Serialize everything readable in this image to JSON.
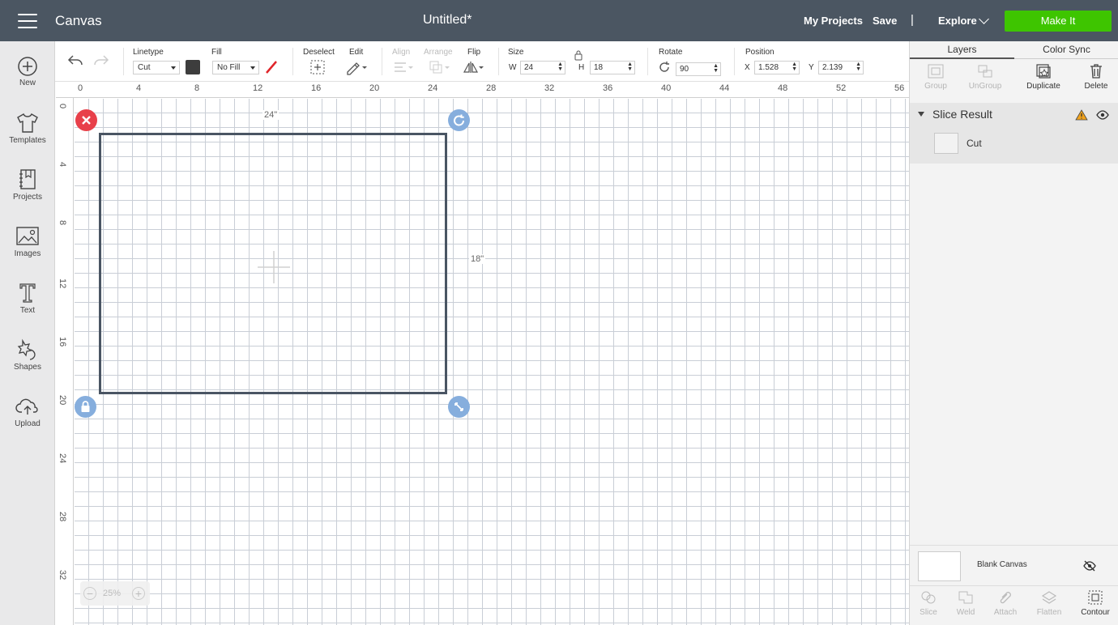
{
  "topbar": {
    "app_title": "Canvas",
    "doc_title": "Untitled*",
    "my_projects": "My Projects",
    "save": "Save",
    "separator": "|",
    "explore": "Explore",
    "make_it": "Make It"
  },
  "sidebar": {
    "items": [
      {
        "label": "New",
        "icon": "plus-circle-icon"
      },
      {
        "label": "Templates",
        "icon": "tshirt-icon"
      },
      {
        "label": "Projects",
        "icon": "notebook-icon"
      },
      {
        "label": "Images",
        "icon": "image-icon"
      },
      {
        "label": "Text",
        "icon": "text-icon"
      },
      {
        "label": "Shapes",
        "icon": "shapes-icon"
      },
      {
        "label": "Upload",
        "icon": "cloud-upload-icon"
      }
    ]
  },
  "toolbar": {
    "linetype_label": "Linetype",
    "linetype_value": "Cut",
    "fill_label": "Fill",
    "fill_value": "No Fill",
    "deselect_label": "Deselect",
    "edit_label": "Edit",
    "align_label": "Align",
    "arrange_label": "Arrange",
    "flip_label": "Flip",
    "size_label": "Size",
    "w_label": "W",
    "w_value": "24",
    "h_label": "H",
    "h_value": "18",
    "rotate_label": "Rotate",
    "rotate_value": "90",
    "position_label": "Position",
    "x_label": "X",
    "x_value": "1.528",
    "y_label": "Y",
    "y_value": "2.139",
    "linetype_color": "#3d3d3d",
    "fill_none_color": "#e0252a"
  },
  "canvas": {
    "ruler_top": [
      "0",
      "4",
      "8",
      "12",
      "16",
      "20",
      "24",
      "28",
      "32",
      "36",
      "40",
      "44",
      "48",
      "52",
      "56"
    ],
    "ruler_left": [
      "0",
      "4",
      "8",
      "12",
      "16",
      "20",
      "24",
      "28",
      "32"
    ],
    "width_dim": "24\"",
    "height_dim": "18\"",
    "zoom": "25%",
    "zoom_out": "−",
    "zoom_in": "+",
    "shape_border_color": "#4a5563"
  },
  "panel": {
    "tabs": [
      "Layers",
      "Color Sync"
    ],
    "buttons": [
      {
        "label": "Group",
        "enabled": false
      },
      {
        "label": "UnGroup",
        "enabled": false
      },
      {
        "label": "Duplicate",
        "enabled": true
      },
      {
        "label": "Delete",
        "enabled": true
      }
    ],
    "layer_group": "Slice Result",
    "layer_item": "Cut",
    "blank_canvas": "Blank Canvas",
    "bottom_tools": [
      {
        "label": "Slice",
        "enabled": false
      },
      {
        "label": "Weld",
        "enabled": false
      },
      {
        "label": "Attach",
        "enabled": false
      },
      {
        "label": "Flatten",
        "enabled": false
      },
      {
        "label": "Contour",
        "enabled": true
      }
    ]
  }
}
